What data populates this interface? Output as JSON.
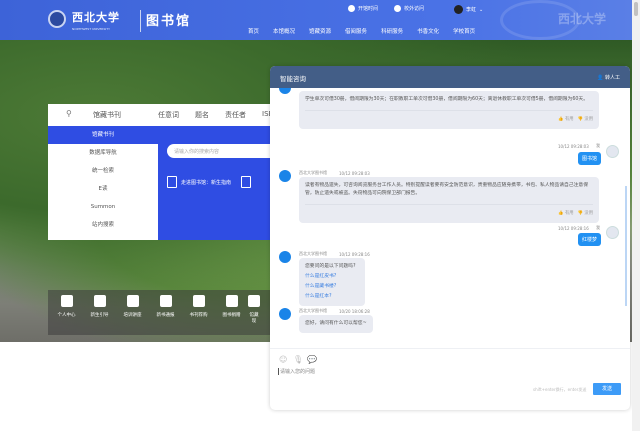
{
  "header": {
    "logo_text": "西北大学",
    "logo_sub": "NORTHWEST UNIVERSITY",
    "library": "图书馆",
    "open_hours": "开馆时间",
    "offcampus": "校外访问",
    "user": "李虹",
    "watermark_text": "西北大学",
    "nav": [
      "首页",
      "本馆概况",
      "馆藏资源",
      "借阅服务",
      "科研服务",
      "书香文化",
      "学校首页"
    ]
  },
  "search": {
    "selected": "馆藏书刊",
    "tabs": [
      "任意词",
      "题名",
      "责任者",
      "ISBN"
    ],
    "menu": [
      "馆藏书刊",
      "数据库导航",
      "统一检索",
      "E读",
      "Summon",
      "站内搜索"
    ],
    "placeholder": "请输入你的搜索内容",
    "guide": "走进图书馆：新生指南"
  },
  "shortcuts": [
    "个人中心",
    "新生引导",
    "培训讲座",
    "新书通报",
    "书刊荐购",
    "图书捐赠",
    "馆藏现"
  ],
  "chat": {
    "title": "智能咨询",
    "transfer": "转人工",
    "msg1": "学生单次可借30册，借阅期限为30天；在职教职工单次可借30册，借阅期限为60天；离退休教职工单次可借5册，借阅期限为60天。",
    "useful": "有用",
    "useless": "没用",
    "u1_time": "10/12 09:28:03",
    "me": "我",
    "u1": "图书馆",
    "bot_name": "西北大学图书馆",
    "b2_time": "10/12 09:28:03",
    "msg2": "读者有物品遗失，可咨询阅览服务台工作人员。特别提醒读者要有安全防范意识，贵重物品应随身携带，书包、私人物品请自己注意保管，防止遗失或被盗。失窃物品可向院保卫部门报告。",
    "u2_time": "10/12 09:28:16",
    "u2": "红楼梦",
    "b3_time": "10/12 09:28:16",
    "msg3": "您要问的是以下问题吗?",
    "suggestions": [
      "什么是红皮书?",
      "什么是藏书楼?",
      "什么是红本?"
    ],
    "b4_time": "10/20 18:06:28",
    "msg4": "您好，请问有什么可以帮您~",
    "placeholder": "请输入您的问题",
    "hint": "shift+enter换行，enter发送",
    "send": "发送"
  }
}
